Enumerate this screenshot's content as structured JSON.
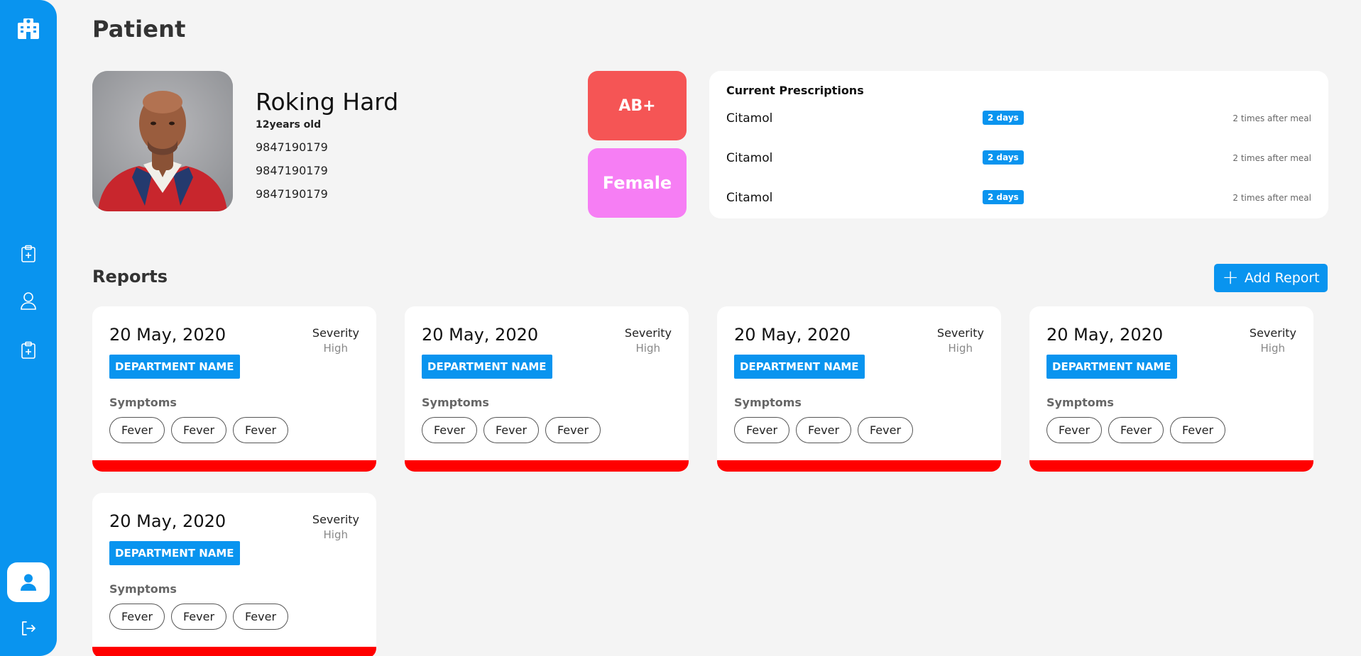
{
  "app": {
    "logo_icon": "hospital-icon",
    "nav_icons": [
      "clipboard-plus-icon",
      "user-icon",
      "clipboard-plus-icon"
    ],
    "active_icon": "user-icon",
    "logout_icon": "logout-icon",
    "accent_color": "#0994ef"
  },
  "page": {
    "title": "Patient"
  },
  "patient": {
    "name": "Roking Hard",
    "age": "12years old",
    "phones": [
      "9847190179",
      "9847190179",
      "9847190179"
    ],
    "blood_group": "AB+",
    "gender": "Female"
  },
  "prescriptions": {
    "title": "Current Prescriptions",
    "items": [
      {
        "medicine": "Citamol",
        "duration": "2 days",
        "note": "2 times after meal"
      },
      {
        "medicine": "Citamol",
        "duration": "2 days",
        "note": "2 times after meal"
      },
      {
        "medicine": "Citamol",
        "duration": "2 days",
        "note": "2 times after meal"
      }
    ]
  },
  "reports": {
    "title": "Reports",
    "add_label": "Add Report",
    "items": [
      {
        "date": "20 May, 2020",
        "severity_label": "Severity",
        "severity": "High",
        "department": "DEPARTMENT NAME",
        "symptoms_label": "Symptoms",
        "symptoms": [
          "Fever",
          "Fever",
          "Fever"
        ]
      },
      {
        "date": "20 May, 2020",
        "severity_label": "Severity",
        "severity": "High",
        "department": "DEPARTMENT NAME",
        "symptoms_label": "Symptoms",
        "symptoms": [
          "Fever",
          "Fever",
          "Fever"
        ]
      },
      {
        "date": "20 May, 2020",
        "severity_label": "Severity",
        "severity": "High",
        "department": "DEPARTMENT NAME",
        "symptoms_label": "Symptoms",
        "symptoms": [
          "Fever",
          "Fever",
          "Fever"
        ]
      },
      {
        "date": "20 May, 2020",
        "severity_label": "Severity",
        "severity": "High",
        "department": "DEPARTMENT NAME",
        "symptoms_label": "Symptoms",
        "symptoms": [
          "Fever",
          "Fever",
          "Fever"
        ]
      },
      {
        "date": "20 May, 2020",
        "severity_label": "Severity",
        "severity": "High",
        "department": "DEPARTMENT NAME",
        "symptoms_label": "Symptoms",
        "symptoms": [
          "Fever",
          "Fever",
          "Fever"
        ]
      }
    ]
  }
}
